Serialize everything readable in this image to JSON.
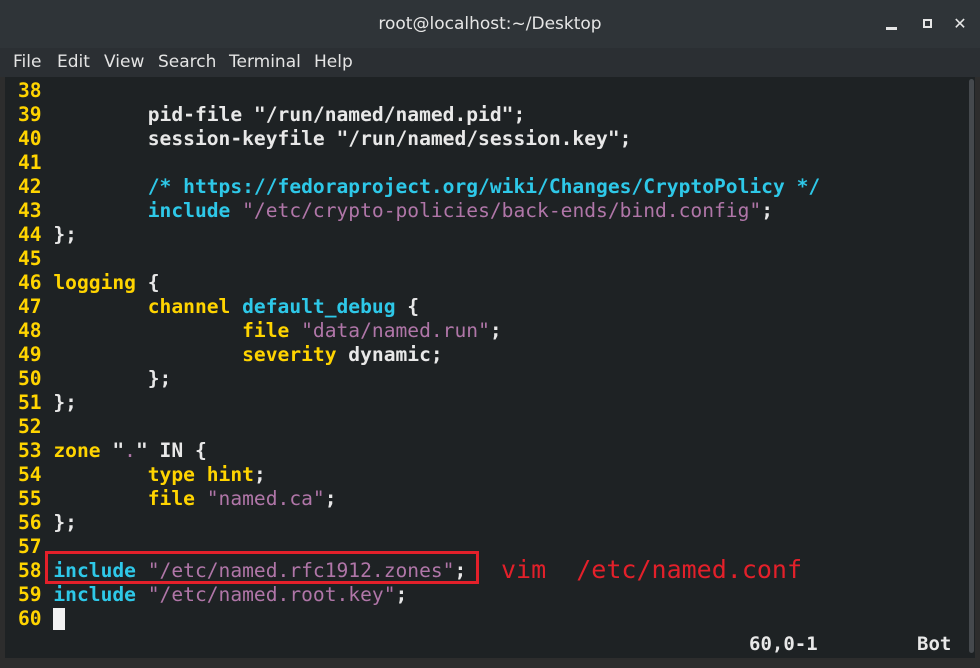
{
  "window": {
    "title": "root@localhost:~/Desktop"
  },
  "menu": [
    "File",
    "Edit",
    "View",
    "Search",
    "Terminal",
    "Help"
  ],
  "lines": [
    {
      "n": "38",
      "segs": []
    },
    {
      "n": "39",
      "segs": [
        {
          "t": "        pid-file \"/run/named/named.pid\";",
          "c": "hl"
        }
      ]
    },
    {
      "n": "40",
      "segs": [
        {
          "t": "        session-keyfile \"/run/named/session.key\";",
          "c": "hl"
        }
      ]
    },
    {
      "n": "41",
      "segs": []
    },
    {
      "n": "42",
      "segs": [
        {
          "t": "        /* https://fedoraproject.org/wiki/Changes/CryptoPolicy */",
          "c": "kw-c"
        }
      ]
    },
    {
      "n": "43",
      "segs": [
        {
          "t": "        include",
          "c": "kw-c"
        },
        {
          "t": " ",
          "c": ""
        },
        {
          "t": "\"/etc/crypto-policies/back-ends/bind.config\"",
          "c": "str"
        },
        {
          "t": ";",
          "c": "hl"
        }
      ]
    },
    {
      "n": "44",
      "segs": [
        {
          "t": "};",
          "c": "hl"
        }
      ]
    },
    {
      "n": "45",
      "segs": []
    },
    {
      "n": "46",
      "segs": [
        {
          "t": "logging",
          "c": "kw-y"
        },
        {
          "t": " {",
          "c": "hl"
        }
      ]
    },
    {
      "n": "47",
      "segs": [
        {
          "t": "        channel",
          "c": "kw-y"
        },
        {
          "t": " ",
          "c": ""
        },
        {
          "t": "default_debug",
          "c": "kw-c"
        },
        {
          "t": " {",
          "c": "hl"
        }
      ]
    },
    {
      "n": "48",
      "segs": [
        {
          "t": "                file",
          "c": "kw-y"
        },
        {
          "t": " ",
          "c": ""
        },
        {
          "t": "\"data/named.run\"",
          "c": "str"
        },
        {
          "t": ";",
          "c": "hl"
        }
      ]
    },
    {
      "n": "49",
      "segs": [
        {
          "t": "                severity",
          "c": "kw-y"
        },
        {
          "t": " dynamic;",
          "c": "hl"
        }
      ]
    },
    {
      "n": "50",
      "segs": [
        {
          "t": "        };",
          "c": "hl"
        }
      ]
    },
    {
      "n": "51",
      "segs": [
        {
          "t": "};",
          "c": "hl"
        }
      ]
    },
    {
      "n": "52",
      "segs": []
    },
    {
      "n": "53",
      "segs": [
        {
          "t": "zone",
          "c": "kw-y"
        },
        {
          "t": " \"",
          "c": "hl"
        },
        {
          "t": ".",
          "c": "str"
        },
        {
          "t": "\" IN {",
          "c": "hl"
        }
      ]
    },
    {
      "n": "54",
      "segs": [
        {
          "t": "        type",
          "c": "kw-y"
        },
        {
          "t": " ",
          "c": ""
        },
        {
          "t": "hint",
          "c": "kw-y"
        },
        {
          "t": ";",
          "c": "hl"
        }
      ]
    },
    {
      "n": "55",
      "segs": [
        {
          "t": "        file",
          "c": "kw-y"
        },
        {
          "t": " ",
          "c": ""
        },
        {
          "t": "\"named.ca\"",
          "c": "str"
        },
        {
          "t": ";",
          "c": "hl"
        }
      ]
    },
    {
      "n": "56",
      "segs": [
        {
          "t": "};",
          "c": "hl"
        }
      ]
    },
    {
      "n": "57",
      "segs": []
    },
    {
      "n": "58",
      "segs": [
        {
          "t": "include",
          "c": "kw-c"
        },
        {
          "t": " ",
          "c": ""
        },
        {
          "t": "\"/etc/named.rfc1912.zones\"",
          "c": "str"
        },
        {
          "t": ";",
          "c": "hl"
        }
      ]
    },
    {
      "n": "59",
      "segs": [
        {
          "t": "include",
          "c": "kw-c"
        },
        {
          "t": " ",
          "c": ""
        },
        {
          "t": "\"/etc/named.root.key\"",
          "c": "str"
        },
        {
          "t": ";",
          "c": "hl"
        }
      ]
    },
    {
      "n": "60",
      "segs": []
    }
  ],
  "annotation": "vim  /etc/named.conf",
  "status": {
    "position": "60,0-1",
    "scroll": "Bot"
  },
  "colors": {
    "line_number": "#ffd400",
    "keyword": "#ffd400",
    "keyword_cyan": "#2ec8e8",
    "string": "#b076a8",
    "annotation": "#e3202a"
  },
  "icons": [
    "minimize-icon",
    "maximize-icon",
    "close-icon"
  ]
}
